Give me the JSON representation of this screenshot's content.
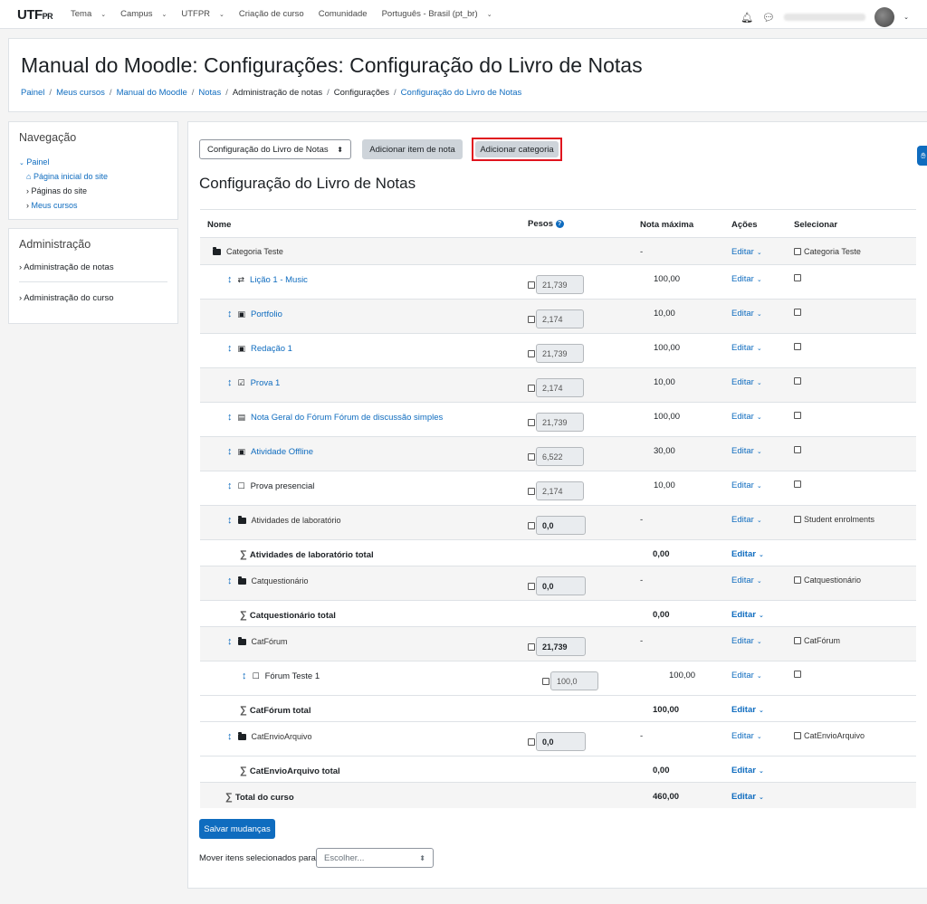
{
  "navbar": {
    "logo_main": "UTF",
    "logo_sub": "PR",
    "menu": [
      {
        "label": "Tema",
        "caret": true
      },
      {
        "label": "Campus",
        "caret": true
      },
      {
        "label": "UTFPR",
        "caret": true
      },
      {
        "label": "Criação de curso",
        "caret": false
      },
      {
        "label": "Comunidade",
        "caret": false
      },
      {
        "label": "Português - Brasil (pt_br)",
        "caret": true
      }
    ]
  },
  "header": {
    "title": "Manual do Moodle: Configurações: Configuração do Livro de Notas",
    "breadcrumb": [
      {
        "label": "Painel",
        "link": true
      },
      {
        "label": "Meus cursos",
        "link": true
      },
      {
        "label": "Manual do Moodle",
        "link": true
      },
      {
        "label": "Notas",
        "link": true
      },
      {
        "label": "Administração de notas",
        "link": false
      },
      {
        "label": "Configurações",
        "link": false
      },
      {
        "label": "Configuração do Livro de Notas",
        "link": true
      }
    ]
  },
  "nav_block": {
    "title": "Navegação",
    "root": "Painel",
    "items": [
      "Página inicial do site",
      "Páginas do site",
      "Meus cursos"
    ]
  },
  "admin_block": {
    "title": "Administração",
    "items": [
      "Administração de notas",
      "Administração do curso"
    ]
  },
  "main": {
    "view_select": "Configuração do Livro de Notas",
    "add_item_button": "Adicionar item de nota",
    "add_category_button": "Adicionar categoria",
    "section_title": "Configuração do Livro de Notas",
    "columns": {
      "name": "Nome",
      "weights": "Pesos",
      "max": "Nota máxima",
      "actions": "Ações",
      "select": "Selecionar"
    },
    "edit_label": "Editar",
    "save_button": "Salvar mudanças",
    "move_label": "Mover itens selecionados para",
    "move_placeholder": "Escolher..."
  },
  "rows": [
    {
      "type": "category",
      "level": 0,
      "name": "Categoria Teste",
      "weight": "",
      "max": "-",
      "select_label": "Categoria Teste"
    },
    {
      "type": "item",
      "level": 1,
      "icon": "lesson-icon",
      "glyph": "⇄",
      "name": "Lição 1 - Music",
      "link": true,
      "weight": "21,739",
      "max": "100,00"
    },
    {
      "type": "item",
      "level": 1,
      "icon": "assignment-icon",
      "glyph": "▣",
      "name": "Portfolio",
      "link": true,
      "weight": "2,174",
      "max": "10,00"
    },
    {
      "type": "item",
      "level": 1,
      "icon": "assignment-icon",
      "glyph": "▣",
      "name": "Redação 1",
      "link": true,
      "weight": "21,739",
      "max": "100,00"
    },
    {
      "type": "item",
      "level": 1,
      "icon": "quiz-icon",
      "glyph": "☑",
      "name": "Prova 1",
      "link": true,
      "weight": "2,174",
      "max": "10,00"
    },
    {
      "type": "item",
      "level": 1,
      "icon": "forum-icon",
      "glyph": "▤",
      "name": "Nota Geral do Fórum Fórum de discussão simples",
      "link": true,
      "weight": "21,739",
      "max": "100,00"
    },
    {
      "type": "item",
      "level": 1,
      "icon": "assignment-icon",
      "glyph": "▣",
      "name": "Atividade Offline",
      "link": true,
      "weight": "6,522",
      "max": "30,00"
    },
    {
      "type": "item",
      "level": 1,
      "icon": "manual-item-icon",
      "glyph": "☐",
      "name": "Prova presencial",
      "link": false,
      "weight": "2,174",
      "max": "10,00"
    },
    {
      "type": "category",
      "level": 1,
      "name": "Atividades de laboratório",
      "weight": "0,0",
      "max": "-",
      "select_label": "Student enrolments"
    },
    {
      "type": "total",
      "level": 1,
      "name": "Atividades de laboratório total",
      "max": "0,00"
    },
    {
      "type": "category",
      "level": 1,
      "name": "Catquestionário",
      "weight": "0,0",
      "max": "-",
      "select_label": "Catquestionário"
    },
    {
      "type": "total",
      "level": 1,
      "name": "Catquestionário total",
      "max": "0,00"
    },
    {
      "type": "category",
      "level": 1,
      "name": "CatFórum",
      "weight": "21,739",
      "max": "-",
      "select_label": "CatFórum"
    },
    {
      "type": "item",
      "level": 2,
      "icon": "manual-item-icon",
      "glyph": "☐",
      "name": "Fórum Teste 1",
      "link": false,
      "weight": "100,0",
      "max": "100,00"
    },
    {
      "type": "total",
      "level": 1,
      "name": "CatFórum total",
      "max": "100,00"
    },
    {
      "type": "category",
      "level": 1,
      "name": "CatEnvioArquivo",
      "weight": "0,0",
      "max": "-",
      "select_label": "CatEnvioArquivo"
    },
    {
      "type": "total",
      "level": 1,
      "name": "CatEnvioArquivo total",
      "max": "0,00"
    },
    {
      "type": "total",
      "level": 0,
      "name": "Total do curso",
      "max": "460,00"
    }
  ]
}
